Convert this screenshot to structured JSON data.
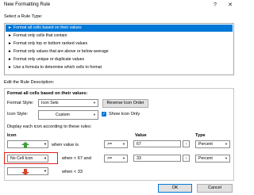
{
  "window": {
    "title": "New Formatting Rule"
  },
  "title_buttons": {
    "help": "?",
    "close": "✕"
  },
  "rule_type": {
    "label": "Select a Rule Type:",
    "items": [
      "Format all cells based on their values",
      "Format only cells that contain",
      "Format only top or bottom ranked values",
      "Format only values that are above or below average",
      "Format only unique or duplicate values",
      "Use a formula to determine which cells to format"
    ],
    "selected_index": 0
  },
  "description": {
    "label": "Edit the Rule Description:",
    "header": "Format all cells based on their values:",
    "format_style_label": "Format Style:",
    "format_style_value": "Icon Sets",
    "reverse_button": "Reverse Icon Order",
    "icon_style_label": "Icon Style:",
    "icon_style_value": "Custom",
    "show_icon_only_label": "Show Icon Only",
    "show_icon_only_checked": true,
    "rules_label": "Display each icon according to these rules:",
    "col_icon": "Icon",
    "col_value": "Value",
    "col_type": "Type",
    "rows": [
      {
        "icon": "green-up-arrow",
        "condition": "when value is",
        "operator": ">=",
        "value": "67",
        "type": "Percent"
      },
      {
        "icon_text": "No Cell Icon",
        "condition": "when < 67 and",
        "operator": ">=",
        "value": "33",
        "type": "Percent"
      },
      {
        "icon": "red-down-arrow",
        "condition": "when < 33"
      }
    ]
  },
  "buttons": {
    "ok": "OK",
    "cancel": "Cancel"
  },
  "colors": {
    "accent": "#0078d7",
    "highlight": "#e2211c",
    "green_arrow": "#3f9f3a",
    "red_arrow": "#d9432b"
  }
}
